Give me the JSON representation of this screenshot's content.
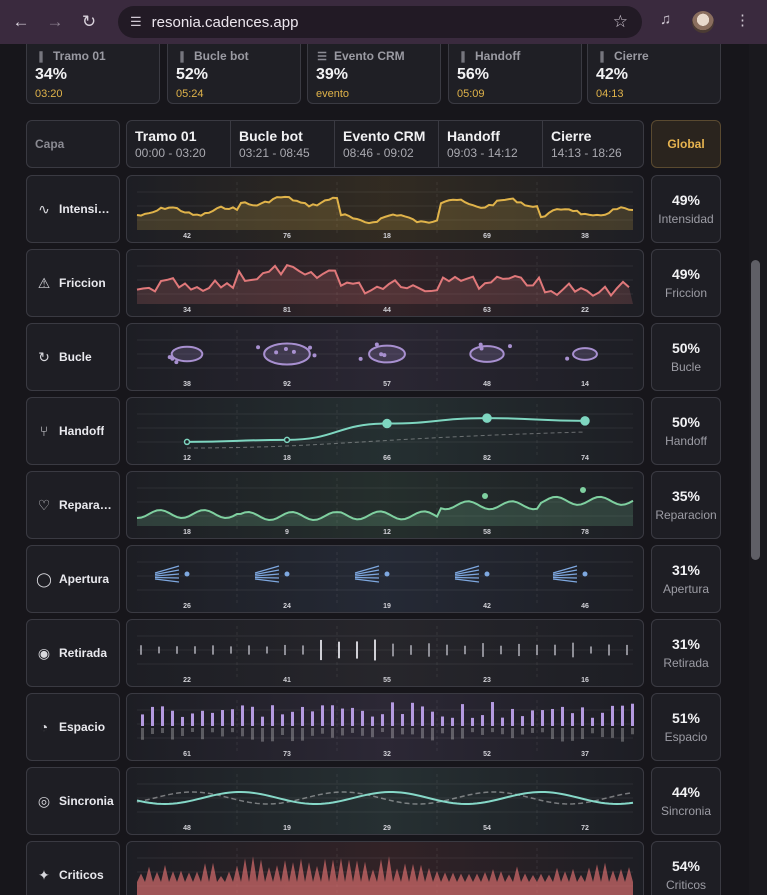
{
  "browser": {
    "url": "resonia.cadences.app"
  },
  "top_cards": [
    {
      "label": "Tramo 01",
      "pct": "34%",
      "sub": "03:20",
      "icon": "waveform-icon"
    },
    {
      "label": "Bucle bot",
      "pct": "52%",
      "sub": "05:24",
      "icon": "waveform-icon"
    },
    {
      "label": "Evento CRM",
      "pct": "39%",
      "sub": "evento",
      "icon": "document-icon"
    },
    {
      "label": "Handoff",
      "pct": "56%",
      "sub": "05:09",
      "icon": "waveform-icon"
    },
    {
      "label": "Cierre",
      "pct": "42%",
      "sub": "04:13",
      "icon": "waveform-icon"
    }
  ],
  "header": {
    "capa": "Capa",
    "global": "Global",
    "segments": [
      {
        "name": "Tramo 01",
        "time": "00:00 - 03:20"
      },
      {
        "name": "Bucle bot",
        "time": "03:21 - 08:45"
      },
      {
        "name": "Evento CRM",
        "time": "08:46 - 09:02"
      },
      {
        "name": "Handoff",
        "time": "09:03 - 14:12"
      },
      {
        "name": "Cierre",
        "time": "14:13 - 18:26"
      }
    ]
  },
  "layers": [
    {
      "key": "intensidad",
      "label": "Intensidad",
      "pct": "49%",
      "stat": "Intensidad",
      "color": "#e0b34a",
      "type": "line",
      "values": [
        42,
        76,
        18,
        69,
        38
      ],
      "icon": "pulse-icon"
    },
    {
      "key": "friccion",
      "label": "Friccion",
      "pct": "49%",
      "stat": "Friccion",
      "color": "#e0787a",
      "type": "jagged",
      "values": [
        34,
        81,
        44,
        63,
        22
      ],
      "icon": "warning-icon"
    },
    {
      "key": "bucle",
      "label": "Bucle",
      "pct": "50%",
      "stat": "Bucle",
      "color": "#a890d0",
      "type": "loops",
      "values": [
        38,
        92,
        57,
        48,
        14
      ],
      "icon": "repeat-icon"
    },
    {
      "key": "handoff",
      "label": "Handoff",
      "pct": "50%",
      "stat": "Handoff",
      "color": "#7ed6c0",
      "type": "step",
      "values": [
        12,
        18,
        66,
        82,
        74
      ],
      "icon": "branch-icon"
    },
    {
      "key": "reparacion",
      "label": "Reparacion",
      "pct": "35%",
      "stat": "Reparacion",
      "color": "#7fd0a0",
      "type": "area",
      "values": [
        18,
        9,
        12,
        58,
        78
      ],
      "icon": "heart-pulse-icon"
    },
    {
      "key": "apertura",
      "label": "Apertura",
      "pct": "31%",
      "stat": "Apertura",
      "color": "#7ea8e0",
      "type": "fans",
      "values": [
        26,
        24,
        19,
        42,
        46
      ],
      "icon": "chat-bubble-icon"
    },
    {
      "key": "retirada",
      "label": "Retirada",
      "pct": "31%",
      "stat": "Retirada",
      "color": "#8e8e96",
      "type": "ticks",
      "values": [
        22,
        41,
        55,
        23,
        16
      ],
      "icon": "eye-icon"
    },
    {
      "key": "espacio",
      "label": "Espacio",
      "pct": "51%",
      "stat": "Espacio",
      "color": "#b49ae0",
      "type": "bars",
      "values": [
        61,
        73,
        32,
        52,
        37
      ],
      "icon": "gauge-icon"
    },
    {
      "key": "sincronia",
      "label": "Sincronia",
      "pct": "44%",
      "stat": "Sincronia",
      "color": "#86d8c8",
      "type": "waves",
      "values": [
        48,
        19,
        29,
        54,
        72
      ],
      "icon": "broadcast-icon"
    },
    {
      "key": "criticos",
      "label": "Criticos",
      "pct": "54%",
      "stat": "Criticos",
      "color": "#e07070",
      "type": "spikes",
      "values": [],
      "icon": "sparkle-icon"
    }
  ]
}
